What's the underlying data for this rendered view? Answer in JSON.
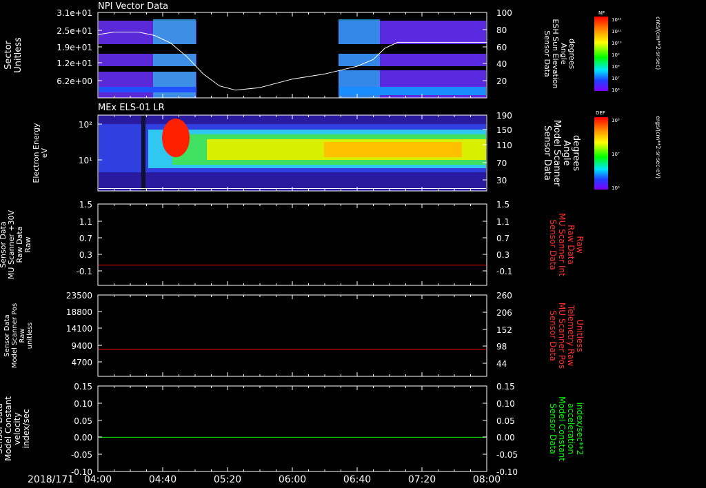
{
  "chart_data": {
    "date_label": "2018/171",
    "time_ticks": [
      "04:00",
      "04:40",
      "05:20",
      "06:00",
      "06:40",
      "07:20",
      "08:00"
    ],
    "panels": [
      {
        "id": "npi",
        "type": "heatmap",
        "title": "NPI Vector Data",
        "left_ylabel": [
          "Sector",
          "Unitless"
        ],
        "left_ticks": [
          "3.1e+01",
          "2.5e+01",
          "1.9e+01",
          "1.2e+01",
          "6.2e+00"
        ],
        "right_ylabel": [
          "Sensor Data",
          "ESH Sun Elevation",
          "Angle",
          "degrees"
        ],
        "right_ticks": [
          "100",
          "80",
          "60",
          "40",
          "20"
        ],
        "data_gap": [
          "05:00",
          "06:25"
        ],
        "line_series": {
          "name": "ESH Sun Elevation Angle",
          "color": "#ffffff",
          "x": [
            "04:00",
            "04:10",
            "04:25",
            "04:35",
            "04:45",
            "04:55",
            "05:05",
            "05:15",
            "05:25",
            "05:40",
            "06:00",
            "06:20",
            "06:40",
            "06:50",
            "06:57",
            "07:05",
            "07:30",
            "08:00"
          ],
          "y": [
            74,
            77,
            77,
            73,
            64,
            48,
            28,
            14,
            9,
            12,
            22,
            28,
            37,
            45,
            58,
            65,
            65,
            65
          ]
        },
        "colorbar": {
          "label": "NF",
          "unit": "cnts/(cm**2-sr-sec)",
          "ticks": [
            "10¹²",
            "10¹¹",
            "10¹⁰",
            "10⁹",
            "10⁸",
            "10⁷",
            "10⁶"
          ]
        }
      },
      {
        "id": "els",
        "type": "heatmap",
        "title": "MEx ELS-01 LR",
        "left_ylabel": [
          "Electron Energy",
          "eV"
        ],
        "left_ticks": [
          "10²",
          "10¹"
        ],
        "right_ylabel": [
          "Sensor Data",
          "Model Scanner",
          "Angle",
          "degrees"
        ],
        "right_ticks": [
          "190",
          "150",
          "110",
          "70",
          "30"
        ],
        "colorbar": {
          "label": "DEF",
          "unit": "ergs/(cm**2-sr-sec-eV)",
          "ticks": [
            "10⁸",
            "10⁷",
            "10⁶"
          ]
        }
      },
      {
        "id": "mu-raw",
        "type": "line",
        "left_ylabel": [
          "Sensor Data",
          "MU Scanner +30V",
          "Raw Data",
          "Raw"
        ],
        "left_ticks": [
          "1.5",
          "1.1",
          "0.7",
          "0.3",
          "-0.1"
        ],
        "right_ylabel": [
          "Sensor Data",
          "MU Scanner Int",
          "Raw Data",
          "Raw"
        ],
        "right_ticks": [
          "1.5",
          "1.1",
          "0.7",
          "0.3",
          "-0.1"
        ],
        "ylim": [
          -0.5,
          1.5
        ],
        "series": [
          {
            "color": "#ff0000",
            "value": 0.0
          }
        ]
      },
      {
        "id": "mu-pos",
        "type": "line",
        "left_ylabel": [
          "Sensor Data",
          "Model Scanner Pos",
          "Raw",
          "unitless"
        ],
        "left_ticks": [
          "23500",
          "18800",
          "14100",
          "9400",
          "4700"
        ],
        "right_ylabel": [
          "Sensor Data",
          "MU Scanner Pos",
          "Telemetry Raw",
          "Unitless"
        ],
        "right_ticks": [
          "260",
          "206",
          "152",
          "98",
          "44"
        ],
        "ylim": [
          0,
          23500
        ],
        "series": [
          {
            "color": "#ff0000",
            "value": 7800
          }
        ]
      },
      {
        "id": "model-const",
        "type": "line",
        "left_ylabel": [
          "Sensor Data",
          "Model Constant",
          "velocity",
          "index/sec"
        ],
        "left_ticks": [
          "0.15",
          "0.10",
          "0.05",
          "0.00",
          "-0.05",
          "-0.10"
        ],
        "right_ylabel": [
          "Sensor Data",
          "Model Constant",
          "acceleration",
          "index/sec**2"
        ],
        "right_ticks": [
          "0.15",
          "0.10",
          "0.05",
          "0.00",
          "-0.05",
          "-0.10"
        ],
        "ylim": [
          -0.1,
          0.15
        ],
        "series": [
          {
            "color": "#00ff00",
            "value": 0.0
          }
        ]
      }
    ]
  }
}
